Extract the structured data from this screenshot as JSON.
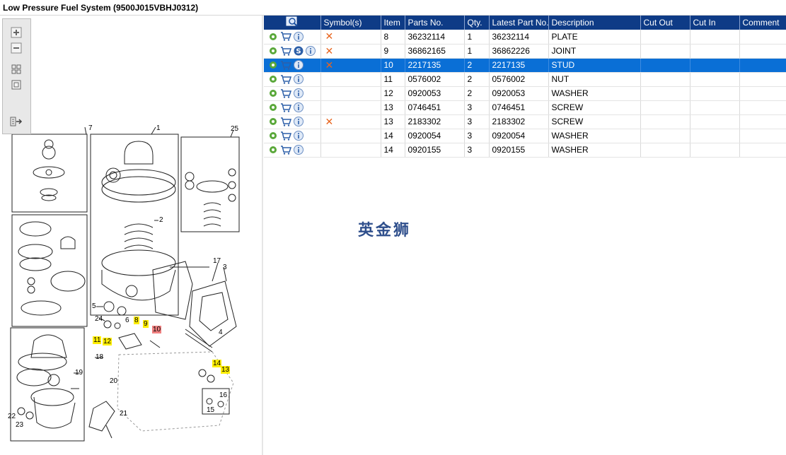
{
  "window": {
    "title": "Low Pressure Fuel System (9500J015VBHJ0312)"
  },
  "toolbar": {
    "icons": [
      "zoom-in-icon",
      "zoom-out-icon",
      "fit-page-icon",
      "actual-size-icon",
      "export-icon"
    ]
  },
  "diagram": {
    "callouts": [
      {
        "label": "7"
      },
      {
        "label": "1"
      },
      {
        "label": "25"
      },
      {
        "label": "2"
      },
      {
        "label": "17"
      },
      {
        "label": "3"
      },
      {
        "label": "5"
      },
      {
        "label": "24"
      },
      {
        "label": "6"
      },
      {
        "label": "8"
      },
      {
        "label": "9"
      },
      {
        "label": "10"
      },
      {
        "label": "4"
      },
      {
        "label": "11"
      },
      {
        "label": "12"
      },
      {
        "label": "18"
      },
      {
        "label": "19"
      },
      {
        "label": "14"
      },
      {
        "label": "13"
      },
      {
        "label": "20"
      },
      {
        "label": "16"
      },
      {
        "label": "15"
      },
      {
        "label": "21"
      },
      {
        "label": "22"
      },
      {
        "label": "23"
      }
    ]
  },
  "grid": {
    "columns": [
      "",
      "Symbol(s)",
      "Item",
      "Parts No.",
      "Qty.",
      "Latest Part No.",
      "Description",
      "Cut Out",
      "Cut In",
      "Comment"
    ],
    "rows": [
      {
        "item": "8",
        "part_no": "36232114",
        "qty": "1",
        "latest": "36232114",
        "desc": "PLATE",
        "s_icon": false,
        "x": true,
        "selected": false
      },
      {
        "item": "9",
        "part_no": "36862165",
        "qty": "1",
        "latest": "36862226",
        "desc": "JOINT",
        "s_icon": true,
        "x": true,
        "selected": false
      },
      {
        "item": "10",
        "part_no": "2217135",
        "qty": "2",
        "latest": "2217135",
        "desc": "STUD",
        "s_icon": false,
        "x": true,
        "selected": true
      },
      {
        "item": "11",
        "part_no": "0576002",
        "qty": "2",
        "latest": "0576002",
        "desc": "NUT",
        "s_icon": false,
        "x": false,
        "selected": false
      },
      {
        "item": "12",
        "part_no": "0920053",
        "qty": "2",
        "latest": "0920053",
        "desc": "WASHER",
        "s_icon": false,
        "x": false,
        "selected": false
      },
      {
        "item": "13",
        "part_no": "0746451",
        "qty": "3",
        "latest": "0746451",
        "desc": "SCREW",
        "s_icon": false,
        "x": false,
        "selected": false
      },
      {
        "item": "13",
        "part_no": "2183302",
        "qty": "3",
        "latest": "2183302",
        "desc": "SCREW",
        "s_icon": false,
        "x": true,
        "selected": false
      },
      {
        "item": "14",
        "part_no": "0920054",
        "qty": "3",
        "latest": "0920054",
        "desc": "WASHER",
        "s_icon": false,
        "x": false,
        "selected": false
      },
      {
        "item": "14",
        "part_no": "0920155",
        "qty": "3",
        "latest": "0920155",
        "desc": "WASHER",
        "s_icon": false,
        "x": false,
        "selected": false
      }
    ]
  },
  "watermark": {
    "text": "英金狮"
  },
  "colors": {
    "header_bg": "#0e3b86",
    "selected_row": "#0a6fd6",
    "highlight": "#ffee00",
    "selected_callout": "#f08080",
    "x_mark": "#e8641d"
  }
}
